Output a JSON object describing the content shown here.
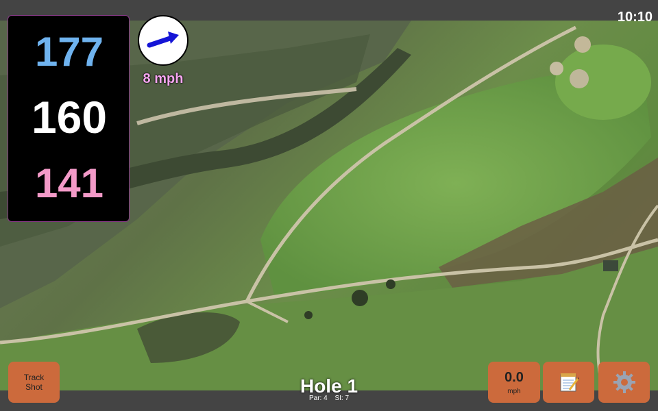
{
  "status": {
    "clock": "10:10"
  },
  "distances": {
    "back": "177",
    "middle": "160",
    "front": "141"
  },
  "wind": {
    "speed": "8 mph",
    "direction_icon": "wind-arrow-icon"
  },
  "buttons": {
    "track_shot": {
      "line1": "Track",
      "line2": "Shot"
    },
    "speed": {
      "value": "0.0",
      "unit": "mph"
    },
    "notes_icon": "notepad-icon",
    "settings_icon": "gear-icon"
  },
  "hole": {
    "title": "Hole 1",
    "par": "Par: 4",
    "si": "SI: 7"
  },
  "colors": {
    "back": "#6fb3ef",
    "middle": "#ffffff",
    "front": "#f39ac8",
    "wind_label": "#f6a6f0",
    "button": "#cc6a3c"
  }
}
